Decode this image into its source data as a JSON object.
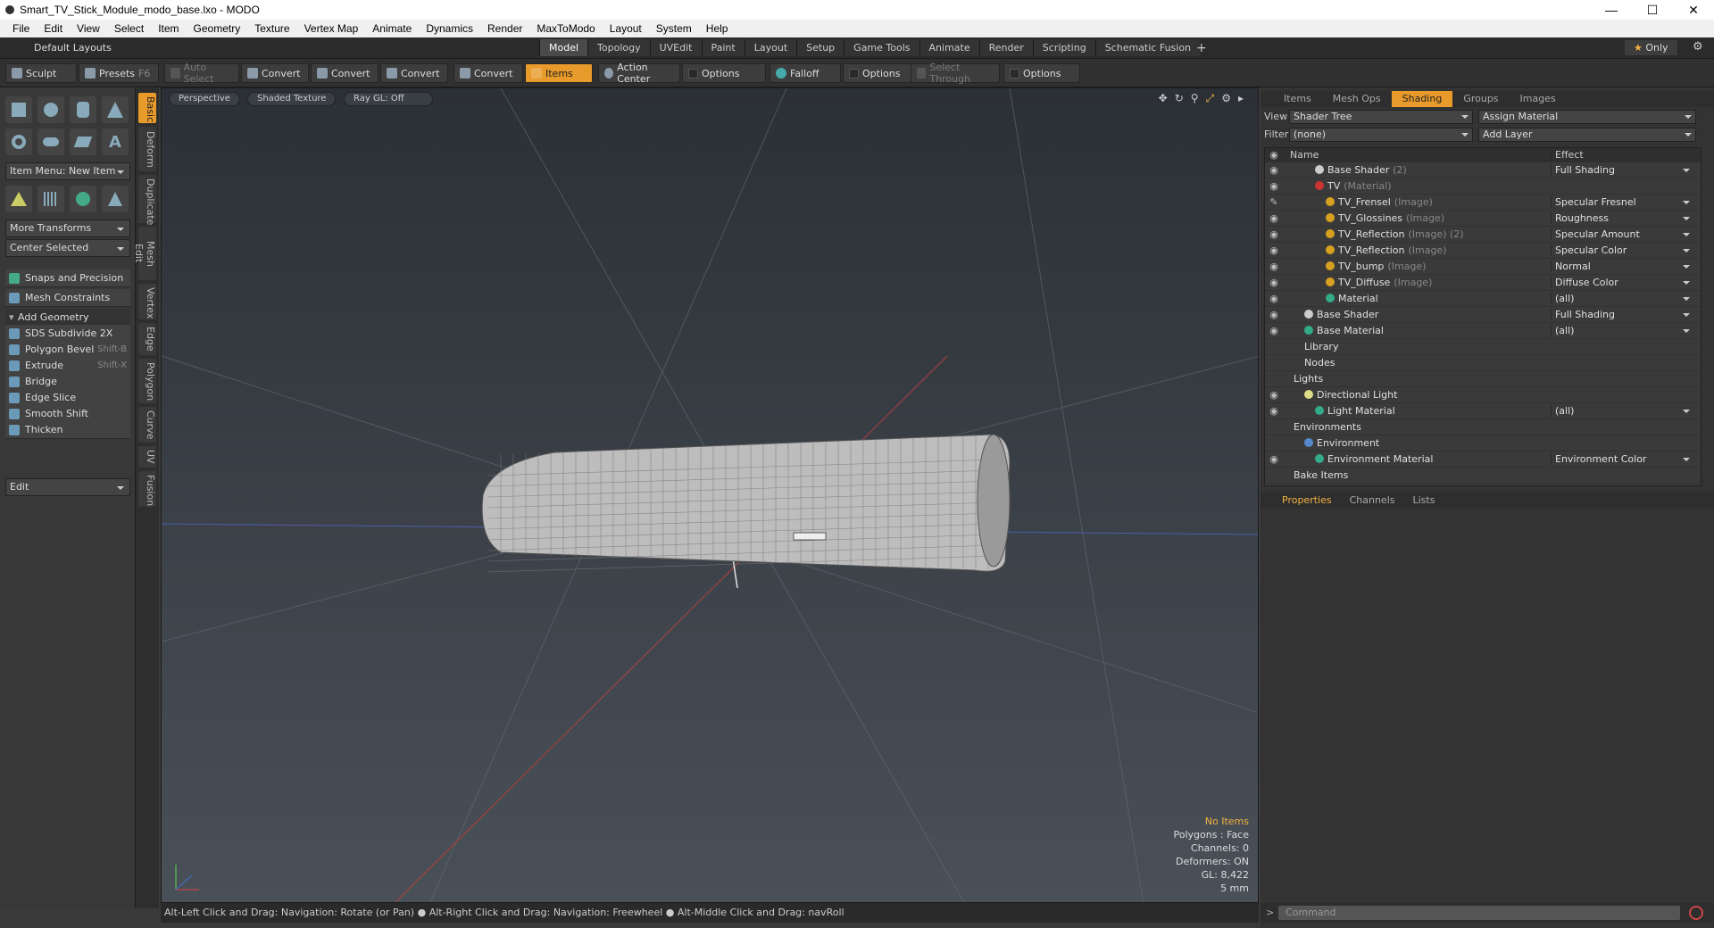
{
  "window": {
    "title": "Smart_TV_Stick_Module_modo_base.lxo - MODO"
  },
  "menu": [
    "File",
    "Edit",
    "View",
    "Select",
    "Item",
    "Geometry",
    "Texture",
    "Vertex Map",
    "Animate",
    "Dynamics",
    "Render",
    "MaxToModo",
    "Layout",
    "System",
    "Help"
  ],
  "layout": {
    "preset": "Default Layouts",
    "tabs": [
      "Model",
      "Topology",
      "UVEdit",
      "Paint",
      "Layout",
      "Setup",
      "Game Tools",
      "Animate",
      "Render",
      "Scripting",
      "Schematic Fusion"
    ],
    "active": "Model",
    "only": "Only"
  },
  "toolbar": {
    "sculpt": "Sculpt",
    "presets": "Presets",
    "presets_key": "F6",
    "auto_select": "Auto Select",
    "convert": "Convert",
    "items": "Items",
    "action_center": "Action Center",
    "options": "Options",
    "falloff": "Falloff",
    "select_through": "Select Through"
  },
  "left": {
    "item_menu": "Item Menu: New Item",
    "more_transforms": "More Transforms",
    "center_selected": "Center Selected",
    "snaps": "Snaps and Precision",
    "mesh_constraints": "Mesh Constraints",
    "add_geometry": "Add Geometry",
    "tools": [
      {
        "label": "SDS Subdivide 2X",
        "key": ""
      },
      {
        "label": "Polygon Bevel",
        "key": "Shift-B"
      },
      {
        "label": "Extrude",
        "key": "Shift-X"
      },
      {
        "label": "Bridge",
        "key": ""
      },
      {
        "label": "Edge Slice",
        "key": ""
      },
      {
        "label": "Smooth Shift",
        "key": ""
      },
      {
        "label": "Thicken",
        "key": ""
      }
    ],
    "edit": "Edit"
  },
  "vtabs": [
    "Basic",
    "Deform",
    "Duplicate",
    "Mesh Edit",
    "Vertex",
    "Edge",
    "Polygon",
    "Curve",
    "UV",
    "Fusion"
  ],
  "viewport": {
    "view": "Perspective",
    "shading": "Shaded Texture",
    "raygl": "Ray GL: Off",
    "stats": {
      "items": "No Items",
      "polygons": "Polygons : Face",
      "channels": "Channels: 0",
      "deformers": "Deformers: ON",
      "gl": "GL: 8,422",
      "unit": "5 mm"
    }
  },
  "status": "Alt-Left Click and Drag: Navigation: Rotate (or Pan) ● Alt-Right Click and Drag: Navigation: Freewheel ● Alt-Middle Click and Drag: navRoll",
  "right": {
    "tabs": [
      "Items",
      "Mesh Ops",
      "Shading",
      "Groups",
      "Images"
    ],
    "active": "Shading",
    "view_label": "View",
    "view_value": "Shader Tree",
    "assign": "Assign Material",
    "filter_label": "Filter",
    "filter_value": "(none)",
    "add_layer": "Add Layer",
    "col_name": "Name",
    "col_effect": "Effect",
    "rows": [
      {
        "ind": 3,
        "name": "Base Shader",
        "sub": "(2)",
        "eff": "Full Shading",
        "eye": "◉",
        "c": "#ccc"
      },
      {
        "ind": 3,
        "name": "TV",
        "sub": "(Material)",
        "eff": "",
        "eye": "◉",
        "c": "#c33"
      },
      {
        "ind": 4,
        "name": "TV_Frensel",
        "sub": "(Image)",
        "eff": "Specular Fresnel",
        "eye": "✎",
        "c": "#d8a020"
      },
      {
        "ind": 4,
        "name": "TV_Glossines",
        "sub": "(Image)",
        "eff": "Roughness",
        "eye": "◉",
        "c": "#d8a020"
      },
      {
        "ind": 4,
        "name": "TV_Reflection",
        "sub": "(Image) (2)",
        "eff": "Specular Amount",
        "eye": "◉",
        "c": "#d8a020"
      },
      {
        "ind": 4,
        "name": "TV_Reflection",
        "sub": "(Image)",
        "eff": "Specular Color",
        "eye": "◉",
        "c": "#d8a020"
      },
      {
        "ind": 4,
        "name": "TV_bump",
        "sub": "(Image)",
        "eff": "Normal",
        "eye": "◉",
        "c": "#d8a020"
      },
      {
        "ind": 4,
        "name": "TV_Diffuse",
        "sub": "(Image)",
        "eff": "Diffuse Color",
        "eye": "◉",
        "c": "#d8a020"
      },
      {
        "ind": 4,
        "name": "Material",
        "sub": "",
        "eff": "(all)",
        "eye": "◉",
        "c": "#3a8"
      },
      {
        "ind": 2,
        "name": "Base Shader",
        "sub": "",
        "eff": "Full Shading",
        "eye": "◉",
        "c": "#ccc"
      },
      {
        "ind": 2,
        "name": "Base Material",
        "sub": "",
        "eff": "(all)",
        "eye": "◉",
        "c": "#3a8"
      },
      {
        "ind": 2,
        "name": "Library",
        "sub": "",
        "eff": "",
        "eye": "",
        "c": ""
      },
      {
        "ind": 2,
        "name": "Nodes",
        "sub": "",
        "eff": "",
        "eye": "",
        "c": ""
      },
      {
        "ind": 1,
        "name": "Lights",
        "sub": "",
        "eff": "",
        "eye": "",
        "c": ""
      },
      {
        "ind": 2,
        "name": "Directional Light",
        "sub": "",
        "eff": "",
        "eye": "◉",
        "c": "#dd8"
      },
      {
        "ind": 3,
        "name": "Light Material",
        "sub": "",
        "eff": "(all)",
        "eye": "◉",
        "c": "#3a8"
      },
      {
        "ind": 1,
        "name": "Environments",
        "sub": "",
        "eff": "",
        "eye": "",
        "c": ""
      },
      {
        "ind": 2,
        "name": "Environment",
        "sub": "",
        "eff": "",
        "eye": "",
        "c": "#58c"
      },
      {
        "ind": 3,
        "name": "Environment Material",
        "sub": "",
        "eff": "Environment Color",
        "eye": "◉",
        "c": "#3a8"
      },
      {
        "ind": 1,
        "name": "Bake Items",
        "sub": "",
        "eff": "",
        "eye": "",
        "c": ""
      }
    ],
    "ptabs": [
      "Properties",
      "Channels",
      "Lists"
    ],
    "command": "Command"
  }
}
